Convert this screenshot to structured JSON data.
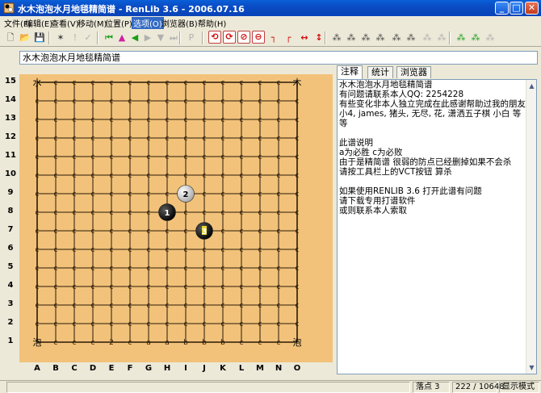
{
  "window": {
    "title": "水木泡泡水月地毯精简谱 - RenLib 3.6 - 2006.07.16",
    "minimize": "_",
    "maximize": "□",
    "close": "✕"
  },
  "menu": [
    {
      "label": "文件(F)"
    },
    {
      "label": "编辑(E)"
    },
    {
      "label": "查看(V)"
    },
    {
      "label": "移动(M)"
    },
    {
      "label": "位置(P)"
    },
    {
      "label": "选项(O)",
      "selected": true
    },
    {
      "label": "浏览器(B)"
    },
    {
      "label": "帮助(H)"
    }
  ],
  "toolbar": {
    "buttons": [
      {
        "name": "new-icon",
        "glyph": "🗋",
        "style": ""
      },
      {
        "name": "open-icon",
        "glyph": "📂",
        "style": ""
      },
      {
        "name": "save-icon",
        "glyph": "💾",
        "style": "dis"
      },
      {
        "name": "mark-icon",
        "glyph": "✶",
        "style": ""
      },
      {
        "name": "exclaim-icon",
        "glyph": "!",
        "style": "dis"
      },
      {
        "name": "check-icon",
        "glyph": "✓",
        "style": "dis"
      },
      {
        "name": "first-move-icon",
        "glyph": "⏮",
        "style": "grn"
      },
      {
        "name": "up-icon",
        "glyph": "▲",
        "style": "mag"
      },
      {
        "name": "back-icon",
        "glyph": "◀",
        "style": "grn"
      },
      {
        "name": "forward-icon",
        "glyph": "▶",
        "style": "dis"
      },
      {
        "name": "down-icon",
        "glyph": "▼",
        "style": "dis"
      },
      {
        "name": "last-move-icon",
        "glyph": "⏭",
        "style": "dis"
      },
      {
        "name": "pass-icon",
        "glyph": "P",
        "style": "dis"
      },
      {
        "name": "rotate-left-icon",
        "glyph": "⟲",
        "style": "red box"
      },
      {
        "name": "rotate-right-icon",
        "glyph": "⟳",
        "style": "red box"
      },
      {
        "name": "rotate-down-icon",
        "glyph": "⊘",
        "style": "red box"
      },
      {
        "name": "rotate-up-icon",
        "glyph": "⊖",
        "style": "red box"
      },
      {
        "name": "flip-corner-left-icon",
        "glyph": "┐",
        "style": "red"
      },
      {
        "name": "flip-corner-right-icon",
        "glyph": "┌",
        "style": "red"
      },
      {
        "name": "flip-horizontal-icon",
        "glyph": "↔",
        "style": "red"
      },
      {
        "name": "flip-vertical-icon",
        "glyph": "↕",
        "style": "red"
      },
      {
        "name": "search-a-icon",
        "glyph": "⁂",
        "style": ""
      },
      {
        "name": "search-b-icon",
        "glyph": "⁂",
        "style": ""
      },
      {
        "name": "search-c-icon",
        "glyph": "⁂",
        "style": ""
      },
      {
        "name": "search-d-icon",
        "glyph": "⁂",
        "style": ""
      },
      {
        "name": "vcf-icon",
        "glyph": "⁂",
        "style": ""
      },
      {
        "name": "vct-icon",
        "glyph": "⁂",
        "style": ""
      },
      {
        "name": "vcf-stop-icon",
        "glyph": "⁂",
        "style": "dis"
      },
      {
        "name": "vct-stop-icon",
        "glyph": "⁂",
        "style": "dis"
      },
      {
        "name": "vcf-plus-icon",
        "glyph": "⁂",
        "style": "grn"
      },
      {
        "name": "vct-plus-icon",
        "glyph": "⁂",
        "style": "grn"
      },
      {
        "name": "stop-icon",
        "glyph": "⁂",
        "style": "dis"
      }
    ]
  },
  "game_title": "水木泡泡水月地毯精简谱",
  "board": {
    "size": 15,
    "rows": [
      "15",
      "14",
      "13",
      "12",
      "11",
      "10",
      "9",
      "8",
      "7",
      "6",
      "5",
      "4",
      "3",
      "2",
      "1"
    ],
    "cols": [
      "A",
      "B",
      "C",
      "D",
      "E",
      "F",
      "G",
      "H",
      "I",
      "J",
      "K",
      "L",
      "M",
      "N",
      "O"
    ],
    "stones": [
      {
        "col": "I",
        "row": 9,
        "color": "white",
        "label": "2"
      },
      {
        "col": "H",
        "row": 8,
        "color": "black",
        "label": "1"
      },
      {
        "col": "J",
        "row": 7,
        "color": "black",
        "label": "3",
        "current": true
      }
    ],
    "corner_marks": [
      {
        "col": "A",
        "row": 15,
        "text": "水"
      },
      {
        "col": "O",
        "row": 15,
        "text": "木"
      },
      {
        "col": "A",
        "row": 1,
        "text": "泡"
      },
      {
        "col": "O",
        "row": 1,
        "text": "泡"
      }
    ],
    "bottom_row_marks": [
      "c",
      "c",
      "c",
      "2",
      "c",
      "a",
      "a",
      "b",
      "b",
      "b",
      "c",
      "c",
      "c"
    ],
    "empty_mark": "c"
  },
  "tabs": [
    {
      "label": "注释",
      "active": true
    },
    {
      "label": "统计",
      "active": false
    },
    {
      "label": "浏览器",
      "active": false
    }
  ],
  "comment_lines": [
    "水木泡泡水月地毯精简谱",
    "有问题请联系本人QQ: 2254228",
    "有些变化非本人独立完成在此感谢帮助过我的朋友",
    "小4, james, 猪头, 无尽, 花, 潇洒五子棋 小白 等等",
    "",
    "此谱说明",
    "a为必胜 c为必败",
    "由于是精简谱 很弱的防点已经删掉如果不会杀",
    "请按工具栏上的VCT按钮 算杀",
    "",
    "如果使用RENLIB 3.6 打开此谱有问题",
    "请下载专用打谱软件",
    "或则联系本人索取"
  ],
  "status": {
    "move_label": "落点 3",
    "position": "222 / 10648",
    "mode": "显示模式"
  },
  "colors": {
    "board": "#f2c27a",
    "titlebar": "#0a4cc4",
    "grid": "#2a1a08"
  }
}
